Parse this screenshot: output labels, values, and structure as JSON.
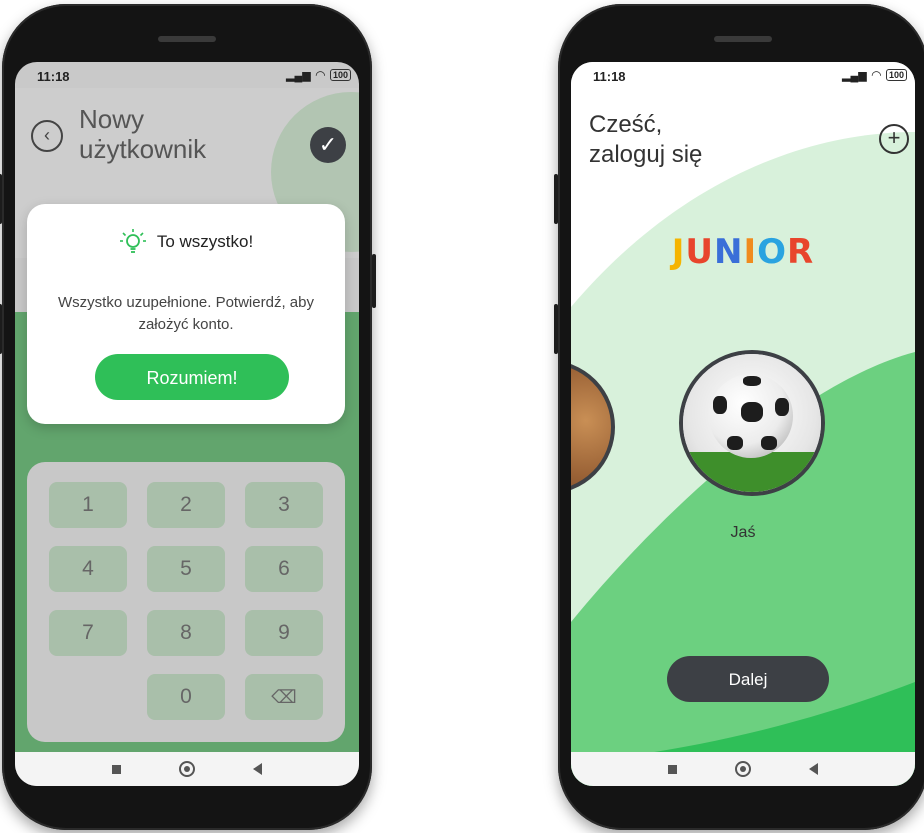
{
  "left_phone": {
    "status": {
      "time": "11:18",
      "battery": "100"
    },
    "header": {
      "title_line1": "Nowy",
      "title_line2": "użytkownik"
    },
    "modal": {
      "title": "To wszystko!",
      "message": "Wszystko uzupełnione. Potwierdź, aby założyć konto.",
      "button": "Rozumiem!"
    },
    "keypad": {
      "keys": [
        "1",
        "2",
        "3",
        "4",
        "5",
        "6",
        "7",
        "8",
        "9",
        "0"
      ]
    }
  },
  "right_phone": {
    "status": {
      "time": "11:18",
      "battery": "100"
    },
    "header": {
      "title_line1": "Cześć,",
      "title_line2": "zaloguj się"
    },
    "logo": {
      "letters": [
        "J",
        "U",
        "N",
        "I",
        "O",
        "R"
      ],
      "colors": [
        "#f5b400",
        "#e8452c",
        "#3a6fd8",
        "#f08b1d",
        "#2aa3e0",
        "#e8452c"
      ]
    },
    "profile": {
      "name": "Jaś"
    },
    "button": "Dalej"
  },
  "colors": {
    "accent_green": "#2fbf58",
    "light_green": "#d8f1db",
    "mid_green": "#6cd080",
    "dark_button": "#3d4045"
  }
}
